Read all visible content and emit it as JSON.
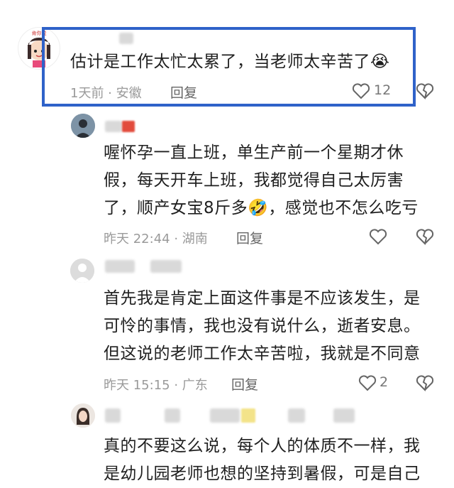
{
  "comments": [
    {
      "text": "估计是工作太忙太累了，当老师太辛苦了",
      "emoji": "😭",
      "meta": "1天前 · 安徽",
      "reply": "回复",
      "likes": "12"
    },
    {
      "lines": [
        "喔怀孕一直上班，单生产前一个星期才休",
        "假，每天开车上班，我都觉得自己太厉害",
        "了，顺产女宝8斤多"
      ],
      "emoji": "🤣",
      "tail": "，感觉也不怎么吃亏",
      "meta": "昨天 22:44 · 湖南",
      "reply": "回复"
    },
    {
      "lines": [
        "首先我是肯定上面这件事是不应该发生，是",
        "可怜的事情，我也没有说什么，逝者安息。",
        "但这说的老师工作太辛苦啦，我就是不同意"
      ],
      "meta": "昨天 15:15 · 广东",
      "reply": "回复",
      "likes": "2"
    },
    {
      "lines": [
        "真的不要这么说，每个人的体质不一样，我",
        "是幼儿园老师也想的坚持到暑假，可是自己"
      ]
    }
  ],
  "avatar_badge_text": "肯你说"
}
